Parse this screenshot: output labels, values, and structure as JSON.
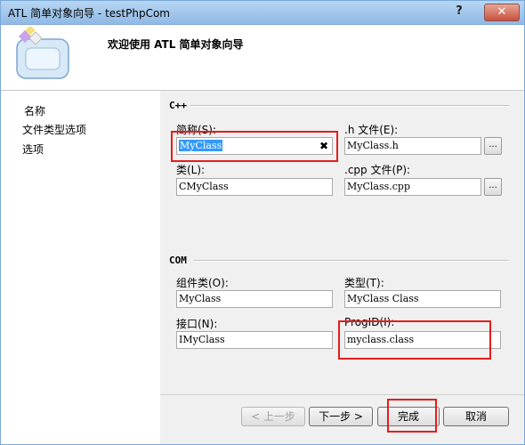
{
  "window": {
    "title": "ATL 简单对象向导 - testPhpCom",
    "help": "?",
    "close": "✕"
  },
  "header": {
    "title": "欢迎使用 ATL 简单对象向导"
  },
  "nav": {
    "items": [
      {
        "label": "名称"
      },
      {
        "label": "文件类型选项"
      },
      {
        "label": "选项"
      }
    ]
  },
  "cpp": {
    "group": "C++",
    "short_name": {
      "label": "简称(S):",
      "value": "MyClass",
      "clear": "✖"
    },
    "h_file": {
      "label": ".h 文件(E):",
      "value": "MyClass.h",
      "browse": "..."
    },
    "class": {
      "label": "类(L):",
      "value": "CMyClass"
    },
    "cpp_file": {
      "label": ".cpp 文件(P):",
      "value": "MyClass.cpp",
      "browse": "..."
    }
  },
  "com": {
    "group": "COM",
    "coclass": {
      "label": "组件类(O):",
      "value": "MyClass"
    },
    "type": {
      "label": "类型(T):",
      "value": "MyClass Class"
    },
    "interface": {
      "label": "接口(N):",
      "value": "IMyClass"
    },
    "progid": {
      "label": "ProgID(I):",
      "value": "myclass.class"
    }
  },
  "buttons": {
    "prev": "< 上一步",
    "next": "下一步 >",
    "finish": "完成",
    "cancel": "取消"
  },
  "accent": {
    "highlight": "#e41d1d",
    "selection": "#3399ff"
  }
}
